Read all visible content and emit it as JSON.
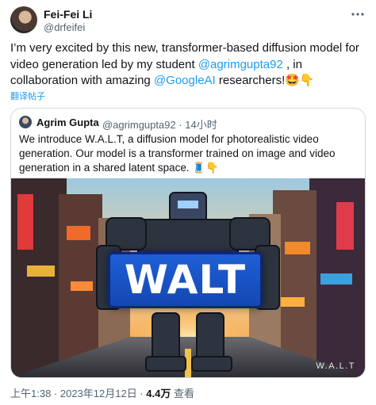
{
  "author": {
    "name": "Fei-Fei Li",
    "handle": "@drfeifei"
  },
  "tweet": {
    "text_1": "I’m very excited by this new, transformer-based diffusion model for video generation led by my student ",
    "mention_1": "@agrimgupta92",
    "text_2": " , in collaboration with amazing ",
    "mention_2": "@GoogleAI",
    "text_3": " researchers!🤩👇"
  },
  "translate_label": "翻译帖子",
  "quote": {
    "name": "Agrim Gupta",
    "meta": "@agrimgupta92 · 14小时",
    "text": "We introduce W.A.L.T, a diffusion model for photorealistic video generation. Our model is a transformer trained on image and video generation in a shared latent space. 🧵👇",
    "media": {
      "sign_text": "WALT",
      "watermark": "W.A.L.T"
    }
  },
  "footer": {
    "time": "上午1:38 · 2023年12月12日 · ",
    "views_count": "4.4万",
    "views_label": " 查看"
  },
  "icons": {
    "more": "more-horizontal-icon"
  }
}
